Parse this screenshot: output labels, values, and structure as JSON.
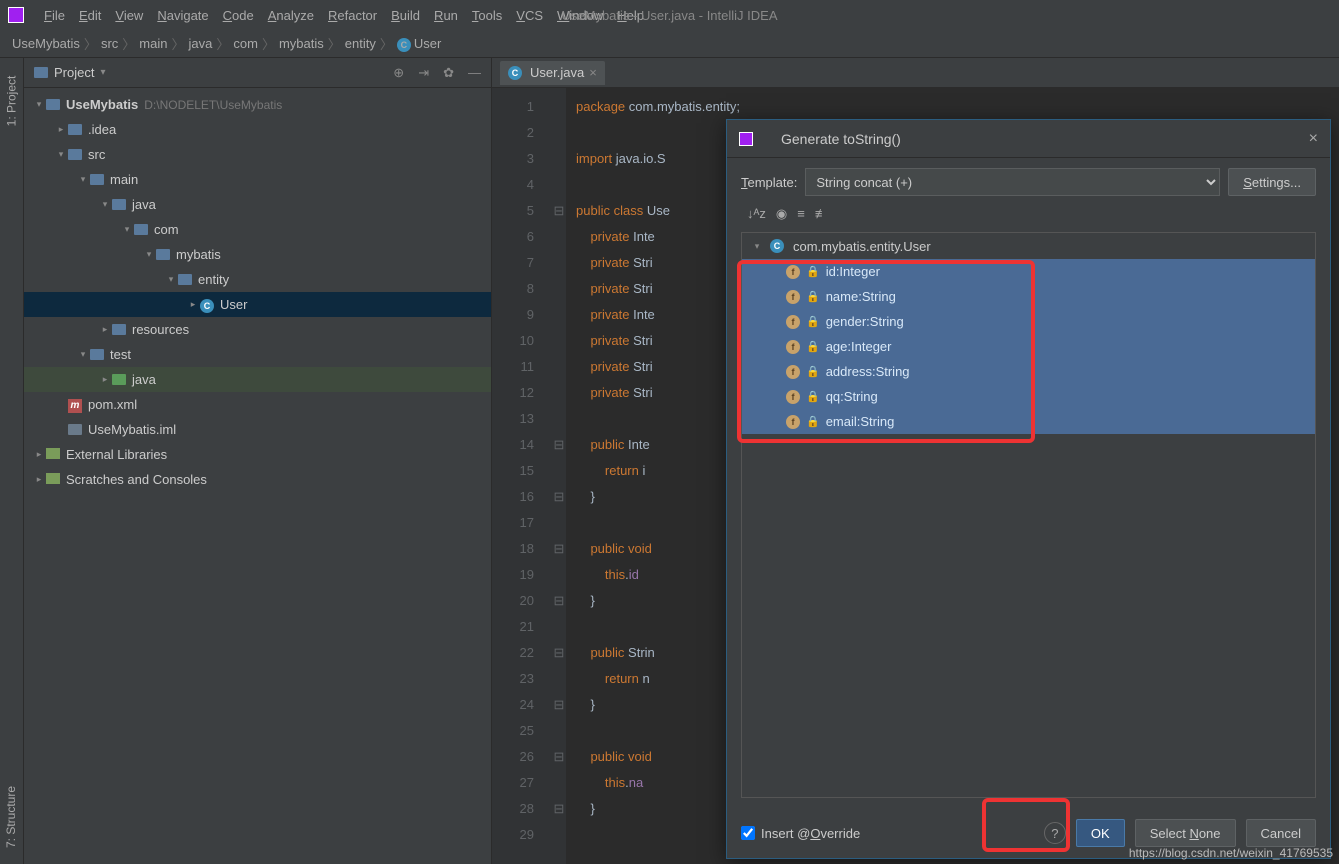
{
  "window_title": "UseMybatis - User.java - IntelliJ IDEA",
  "menu": [
    "File",
    "Edit",
    "View",
    "Navigate",
    "Code",
    "Analyze",
    "Refactor",
    "Build",
    "Run",
    "Tools",
    "VCS",
    "Window",
    "Help"
  ],
  "breadcrumb": {
    "items": [
      "UseMybatis",
      "src",
      "main",
      "java",
      "com",
      "mybatis",
      "entity",
      "User"
    ]
  },
  "project_panel": {
    "title": "Project",
    "rows": [
      {
        "indent": 0,
        "tw": "▾",
        "icon": "folder",
        "bold": true,
        "name": "UseMybatis",
        "path": "D:\\NODELET\\UseMybatis"
      },
      {
        "indent": 1,
        "tw": "▸",
        "icon": "folder",
        "name": ".idea"
      },
      {
        "indent": 1,
        "tw": "▾",
        "icon": "folder",
        "name": "src"
      },
      {
        "indent": 2,
        "tw": "▾",
        "icon": "folder",
        "name": "main"
      },
      {
        "indent": 3,
        "tw": "▾",
        "icon": "folder",
        "name": "java"
      },
      {
        "indent": 4,
        "tw": "▾",
        "icon": "folder",
        "name": "com"
      },
      {
        "indent": 5,
        "tw": "▾",
        "icon": "folder",
        "name": "mybatis"
      },
      {
        "indent": 6,
        "tw": "▾",
        "icon": "folder",
        "name": "entity"
      },
      {
        "indent": 7,
        "tw": "▸",
        "icon": "class",
        "name": "User",
        "sel": true
      },
      {
        "indent": 3,
        "tw": "▸",
        "icon": "folder",
        "name": "resources"
      },
      {
        "indent": 2,
        "tw": "▾",
        "icon": "folder",
        "name": "test"
      },
      {
        "indent": 3,
        "tw": "▸",
        "icon": "folder-green",
        "name": "java",
        "testjava": true
      },
      {
        "indent": 1,
        "tw": "",
        "icon": "maven",
        "name": "pom.xml"
      },
      {
        "indent": 1,
        "tw": "",
        "icon": "file",
        "name": "UseMybatis.iml"
      },
      {
        "indent": 0,
        "tw": "▸",
        "icon": "lib",
        "name": "External Libraries"
      },
      {
        "indent": 0,
        "tw": "▸",
        "icon": "scratch",
        "name": "Scratches and Consoles"
      }
    ]
  },
  "left_rail": {
    "project": "1: Project",
    "structure": "7: Structure"
  },
  "editor": {
    "tab": "User.java",
    "lines": [
      {
        "n": 1,
        "html": "<span class='kw'>package</span> com.mybatis.entity;"
      },
      {
        "n": 2,
        "html": ""
      },
      {
        "n": 3,
        "html": "<span class='kw'>import</span> java.io.S"
      },
      {
        "n": 4,
        "html": ""
      },
      {
        "n": 5,
        "html": "<span class='kw'>public class</span> Use"
      },
      {
        "n": 6,
        "html": "    <span class='kw'>private</span> Inte"
      },
      {
        "n": 7,
        "html": "    <span class='kw'>private</span> Stri"
      },
      {
        "n": 8,
        "html": "    <span class='kw'>private</span> Stri"
      },
      {
        "n": 9,
        "html": "    <span class='kw'>private</span> Inte"
      },
      {
        "n": 10,
        "html": "    <span class='kw'>private</span> Stri"
      },
      {
        "n": 11,
        "html": "    <span class='kw'>private</span> Stri"
      },
      {
        "n": 12,
        "html": "    <span class='kw'>private</span> Stri"
      },
      {
        "n": 13,
        "html": ""
      },
      {
        "n": 14,
        "html": "    <span class='kw'>public</span> Inte"
      },
      {
        "n": 15,
        "html": "        <span class='kw'>return</span> i"
      },
      {
        "n": 16,
        "html": "    }"
      },
      {
        "n": 17,
        "html": ""
      },
      {
        "n": 18,
        "html": "    <span class='kw'>public void</span>"
      },
      {
        "n": 19,
        "html": "        <span class='kw'>this</span>.<span class='fld2'>id</span>"
      },
      {
        "n": 20,
        "html": "    }"
      },
      {
        "n": 21,
        "html": ""
      },
      {
        "n": 22,
        "html": "    <span class='kw'>public</span> Strin"
      },
      {
        "n": 23,
        "html": "        <span class='kw'>return</span> n"
      },
      {
        "n": 24,
        "html": "    }"
      },
      {
        "n": 25,
        "html": ""
      },
      {
        "n": 26,
        "html": "    <span class='kw'>public void</span>"
      },
      {
        "n": 27,
        "html": "        <span class='kw'>this</span>.<span class='fld2'>na</span>"
      },
      {
        "n": 28,
        "html": "    }"
      },
      {
        "n": 29,
        "html": ""
      }
    ],
    "folds": {
      "5": "⊟",
      "14": "⊟",
      "16": "⊟",
      "18": "⊟",
      "20": "⊟",
      "22": "⊟",
      "24": "⊟",
      "26": "⊟",
      "28": "⊟"
    }
  },
  "dialog": {
    "title": "Generate toString()",
    "template_label": "Template:",
    "template_value": "String concat (+)",
    "settings_btn": "Settings...",
    "class_name": "com.mybatis.entity.User",
    "fields": [
      {
        "name": "id",
        "type": "Integer"
      },
      {
        "name": "name",
        "type": "String"
      },
      {
        "name": "gender",
        "type": "String"
      },
      {
        "name": "age",
        "type": "Integer"
      },
      {
        "name": "address",
        "type": "String"
      },
      {
        "name": "qq",
        "type": "String"
      },
      {
        "name": "email",
        "type": "String"
      }
    ],
    "insert_override": "Insert @Override",
    "insert_override_checked": true,
    "ok": "OK",
    "select_none": "Select None",
    "cancel": "Cancel"
  },
  "watermark": "https://blog.csdn.net/weixin_41769535"
}
